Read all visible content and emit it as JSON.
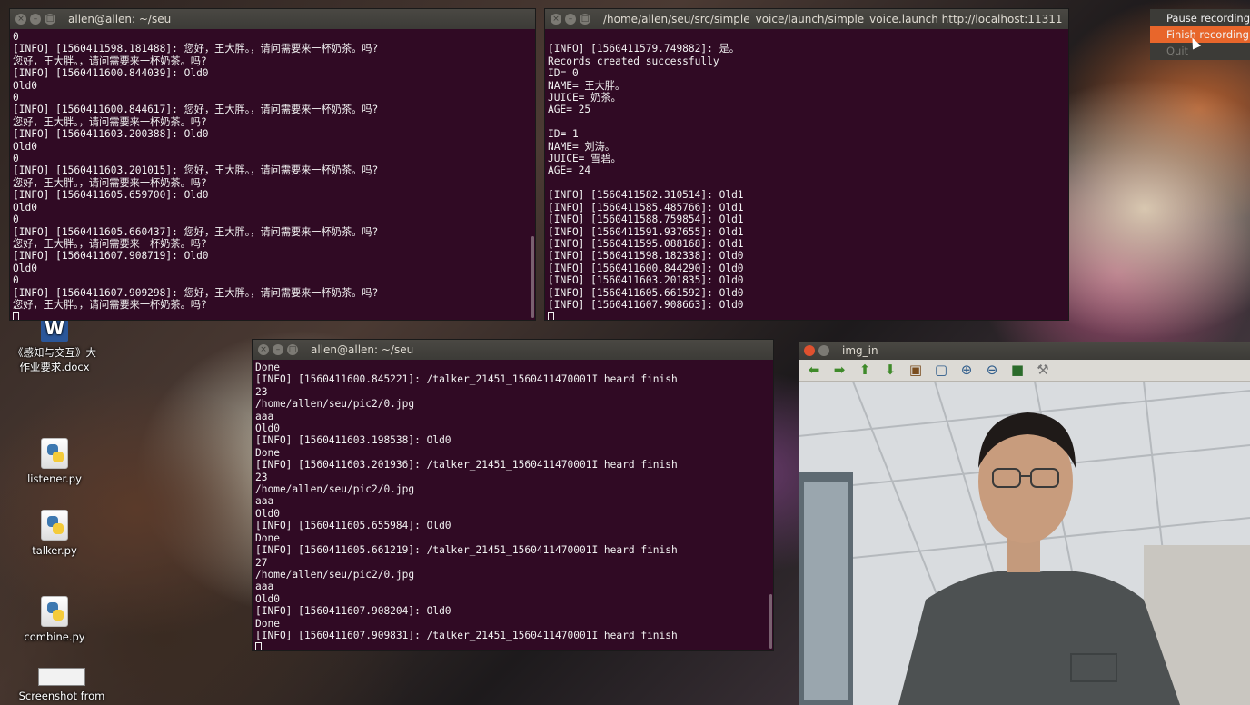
{
  "terminal1": {
    "title": "allen@allen: ~/seu",
    "lines": [
      "0",
      "[INFO] [1560411598.181488]: 您好，王大胖。，请问需要来一杯奶茶。吗?",
      "您好，王大胖。，请问需要来一杯奶茶。吗?",
      "[INFO] [1560411600.844039]: Old0",
      "Old0",
      "0",
      "[INFO] [1560411600.844617]: 您好，王大胖。，请问需要来一杯奶茶。吗?",
      "您好，王大胖。，请问需要来一杯奶茶。吗?",
      "[INFO] [1560411603.200388]: Old0",
      "Old0",
      "0",
      "[INFO] [1560411603.201015]: 您好，王大胖。，请问需要来一杯奶茶。吗?",
      "您好，王大胖。，请问需要来一杯奶茶。吗?",
      "[INFO] [1560411605.659700]: Old0",
      "Old0",
      "0",
      "[INFO] [1560411605.660437]: 您好，王大胖。，请问需要来一杯奶茶。吗?",
      "您好，王大胖。，请问需要来一杯奶茶。吗?",
      "[INFO] [1560411607.908719]: Old0",
      "Old0",
      "0",
      "[INFO] [1560411607.909298]: 您好，王大胖。，请问需要来一杯奶茶。吗?",
      "您好，王大胖。，请问需要来一杯奶茶。吗?"
    ]
  },
  "terminal2": {
    "title": "/home/allen/seu/src/simple_voice/launch/simple_voice.launch http://localhost:11311",
    "lines": [
      "",
      "[INFO] [1560411579.749882]: 是。",
      "Records created successfully",
      "ID= 0",
      "NAME= 王大胖。",
      "JUICE= 奶茶。",
      "AGE= 25",
      "",
      "ID= 1",
      "NAME= 刘涛。",
      "JUICE= 雪碧。",
      "AGE= 24",
      "",
      "[INFO] [1560411582.310514]: Old1",
      "[INFO] [1560411585.485766]: Old1",
      "[INFO] [1560411588.759854]: Old1",
      "[INFO] [1560411591.937655]: Old1",
      "[INFO] [1560411595.088168]: Old1",
      "[INFO] [1560411598.182338]: Old0",
      "[INFO] [1560411600.844290]: Old0",
      "[INFO] [1560411603.201835]: Old0",
      "[INFO] [1560411605.661592]: Old0",
      "[INFO] [1560411607.908663]: Old0"
    ]
  },
  "terminal3": {
    "title": "allen@allen: ~/seu",
    "lines": [
      "Done",
      "[INFO] [1560411600.845221]: /talker_21451_1560411470001I heard finish",
      "23",
      "/home/allen/seu/pic2/0.jpg",
      "aaa",
      "Old0",
      "[INFO] [1560411603.198538]: Old0",
      "Done",
      "[INFO] [1560411603.201936]: /talker_21451_1560411470001I heard finish",
      "23",
      "/home/allen/seu/pic2/0.jpg",
      "aaa",
      "Old0",
      "[INFO] [1560411605.655984]: Old0",
      "Done",
      "[INFO] [1560411605.661219]: /talker_21451_1560411470001I heard finish",
      "27",
      "/home/allen/seu/pic2/0.jpg",
      "aaa",
      "Old0",
      "[INFO] [1560411607.908204]: Old0",
      "Done",
      "[INFO] [1560411607.909831]: /talker_21451_1560411470001I heard finish"
    ]
  },
  "recording_menu": {
    "pause": "Pause recording",
    "finish": "Finish recording",
    "quit": "Quit"
  },
  "image_viewer": {
    "title": "img_in",
    "tools": [
      "arrow-left-icon",
      "arrow-right-icon",
      "arrow-up-icon",
      "arrow-down-icon",
      "image-icon",
      "zoom-fit-icon",
      "zoom-in-icon",
      "zoom-out-icon",
      "save-icon",
      "settings-icon"
    ]
  },
  "desktop": {
    "icons": [
      {
        "label": "《感知与交互》大作业要求.docx",
        "type": "word"
      },
      {
        "label": "listener.py",
        "type": "python"
      },
      {
        "label": "talker.py",
        "type": "python"
      },
      {
        "label": "combine.py",
        "type": "python"
      },
      {
        "label": "Screenshot from",
        "type": "image"
      }
    ]
  },
  "colors": {
    "terminal_bg": "#300a24",
    "menu_active": "#e8662b",
    "titlebar": "#3c3b37"
  }
}
